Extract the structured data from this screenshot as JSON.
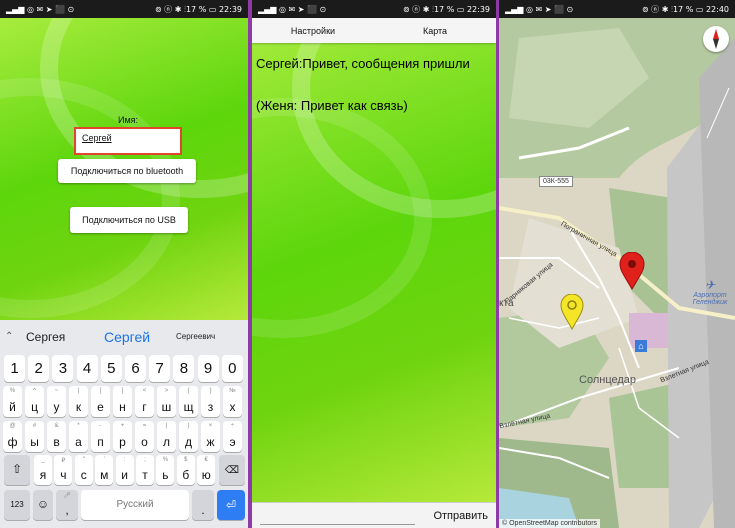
{
  "screen1": {
    "status": {
      "left": "▂▄▆ ◎ ✉ ➤ ⬛ ⊙",
      "right": "⊚ ⓝ ✱ ⫶17 % ▭ 22:39"
    },
    "name_label": "Имя:",
    "name_value": "Сергей",
    "bt_button": "Подключиться по bluetooth",
    "usb_button": "Подключиться по USB",
    "suggestions": [
      "Сергея",
      "Сергей",
      "Сергеевич"
    ],
    "number_row": [
      "1",
      "2",
      "3",
      "4",
      "5",
      "6",
      "7",
      "8",
      "9",
      "0"
    ],
    "row1": [
      {
        "c": "й",
        "h": "%"
      },
      {
        "c": "ц",
        "h": "^"
      },
      {
        "c": "у",
        "h": "~"
      },
      {
        "c": "к",
        "h": "|"
      },
      {
        "c": "е",
        "h": "["
      },
      {
        "c": "н",
        "h": "]"
      },
      {
        "c": "г",
        "h": "<"
      },
      {
        "c": "ш",
        "h": ">"
      },
      {
        "c": "щ",
        "h": "{"
      },
      {
        "c": "з",
        "h": "}"
      },
      {
        "c": "х",
        "h": "№"
      }
    ],
    "row2": [
      {
        "c": "ф",
        "h": "@"
      },
      {
        "c": "ы",
        "h": "#"
      },
      {
        "c": "в",
        "h": "&"
      },
      {
        "c": "а",
        "h": "*"
      },
      {
        "c": "п",
        "h": "-"
      },
      {
        "c": "р",
        "h": "+"
      },
      {
        "c": "о",
        "h": "="
      },
      {
        "c": "л",
        "h": "("
      },
      {
        "c": "д",
        "h": ")"
      },
      {
        "c": "ж",
        "h": "×"
      },
      {
        "c": "э",
        "h": "÷"
      }
    ],
    "row3": [
      {
        "c": "я",
        "h": "_"
      },
      {
        "c": "ч",
        "h": "₽"
      },
      {
        "c": "с",
        "h": "\""
      },
      {
        "c": "м",
        "h": "'"
      },
      {
        "c": "и",
        "h": ":"
      },
      {
        "c": "т",
        "h": ";"
      },
      {
        "c": "ь",
        "h": "%"
      },
      {
        "c": "б",
        "h": "$"
      },
      {
        "c": "ю",
        "h": "€"
      }
    ],
    "key_123": "123",
    "space_label": "Русский",
    "comma": ",",
    "dot": "."
  },
  "screen2": {
    "status": {
      "left": "▂▄▆ ◎ ✉ ➤ ⬛ ⊙",
      "right": "⊚ ⓝ ✱ ⫶17 % ▭ 22:39"
    },
    "menu_settings": "Настройки",
    "menu_map": "Карта",
    "message1": "Сергей:Привет, сообщения пришли",
    "message2": "(Женя: Привет как связь)",
    "send_button": "Отправить"
  },
  "screen3": {
    "status": {
      "left": "▂▄▆ ◎ ✉ ➤ ⬛ ⊙",
      "right": "⊚ ⓝ ✱ ⫶17 % ▭ 22:40"
    },
    "road_code": "03К-555",
    "street1": "Пограничная улица",
    "street2": "Взлетная улица",
    "street3": "Взлётная улица",
    "street4": "Парниковая улица",
    "district": "Солнцедар",
    "airport": "Аэропорт Геленджик",
    "area_label": "кта",
    "attribution": "© OpenStreetMap contributors"
  },
  "colors": {
    "marker_red": "#e0201b",
    "marker_yellow": "#f4e626",
    "field_border": "#e0462b"
  }
}
